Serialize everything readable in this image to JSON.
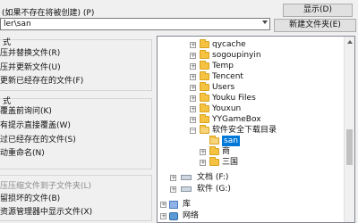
{
  "top": {
    "folder_hint": "(如果不存在将被创建) (P)",
    "path_value": "ler\\san",
    "show_button": "显示(D)",
    "new_folder_button": "新建文件夹(E)"
  },
  "update_mode": {
    "title": "式",
    "options": [
      "压并替换文件(R)",
      "压并更新文件(U)",
      "更新已经存在的文件(F)"
    ]
  },
  "overwrite_mode": {
    "title": "式",
    "options": [
      "覆盖前询问(K)",
      "有提示直接覆盖(W)",
      "过已经存在的文件(S)",
      "动重命名(N)"
    ]
  },
  "misc": {
    "options": [
      "压压缩文件到子文件夹(L)",
      "留损坏的文件(B)",
      "资源管理器中显示文件(X)"
    ]
  },
  "tree": {
    "items": [
      {
        "label": "qycache",
        "indent": 0
      },
      {
        "label": "sogoupinyin",
        "indent": 0
      },
      {
        "label": "Temp",
        "indent": 0
      },
      {
        "label": "Tencent",
        "indent": 0
      },
      {
        "label": "Users",
        "indent": 0
      },
      {
        "label": "Youku Files",
        "indent": 0
      },
      {
        "label": "Youxun",
        "indent": 0
      },
      {
        "label": "YYGameBox",
        "indent": 0
      },
      {
        "label": "软件安全下载目录",
        "indent": 0
      },
      {
        "label": "san",
        "indent": 1
      },
      {
        "label": "商",
        "indent": 1
      },
      {
        "label": "三国",
        "indent": 1
      }
    ],
    "drive_f": "文档 (F:)",
    "drive_g": "软件 (G:)",
    "library": "库",
    "network": "网络"
  },
  "colors": {
    "selection": "#0078d7",
    "folder": "#f5c242"
  }
}
